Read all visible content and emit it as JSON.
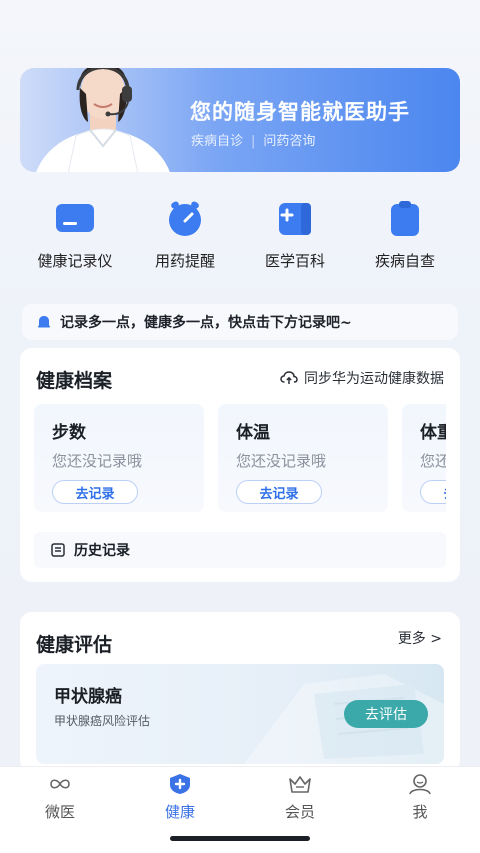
{
  "banner": {
    "title": "您的随身智能就医助手",
    "links": [
      "疾病自诊",
      "问药咨询"
    ],
    "separator": "|"
  },
  "quick_actions": [
    {
      "label": "健康记录仪",
      "icon": "monitor-icon"
    },
    {
      "label": "用药提醒",
      "icon": "clock-icon"
    },
    {
      "label": "医学百科",
      "icon": "medical-book-icon"
    },
    {
      "label": "疾病自查",
      "icon": "clipboard-icon"
    }
  ],
  "notice": {
    "text": "记录多一点，健康多一点，快点击下方记录吧~"
  },
  "records": {
    "title": "健康档案",
    "sync_label": "同步华为运动健康数据",
    "empty_text": "您还没记录哦",
    "button_label": "去记录",
    "metrics": [
      {
        "name": "步数",
        "empty": "您还没记录哦",
        "button": "去记录"
      },
      {
        "name": "体温",
        "empty": "您还没记录哦",
        "button": "去记录"
      },
      {
        "name": "体重",
        "empty": "您还没记录哦",
        "button": "去记录"
      }
    ],
    "history_label": "历史记录"
  },
  "assessment": {
    "title": "健康评估",
    "more_label": "更多 >",
    "item": {
      "name": "甲状腺癌",
      "subtitle": "甲状腺癌风险评估",
      "button": "去评估"
    }
  },
  "tabbar": [
    {
      "label": "微医",
      "icon": "infinity-icon",
      "active": false
    },
    {
      "label": "健康",
      "icon": "plus-shield-icon",
      "active": true
    },
    {
      "label": "会员",
      "icon": "crown-icon",
      "active": false
    },
    {
      "label": "我",
      "icon": "user-icon",
      "active": false
    }
  ],
  "colors": {
    "accent": "#3b73e6",
    "banner_gradient_end": "#4b86ef",
    "assess_button": "#3ba8aa",
    "record_button_text": "#2f6fe8"
  }
}
